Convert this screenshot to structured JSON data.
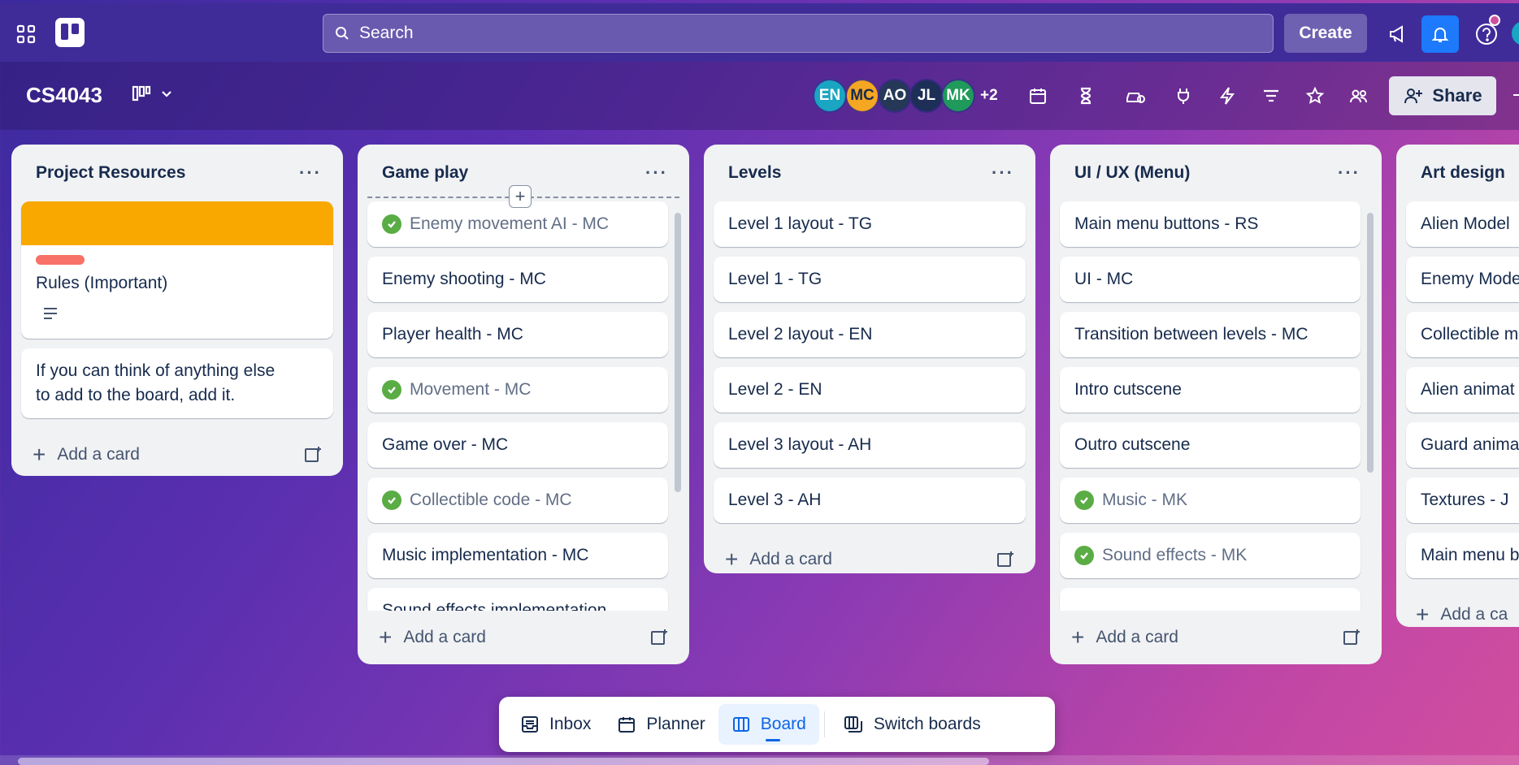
{
  "topbar": {
    "search_placeholder": "Search",
    "create_label": "Create"
  },
  "board": {
    "title": "CS4043",
    "members": [
      {
        "initials": "EN",
        "color": "#1aa5c2"
      },
      {
        "initials": "MC",
        "color": "#f5a623"
      },
      {
        "initials": "AO",
        "color": "#253858"
      },
      {
        "initials": "JL",
        "color": "#1d2f57"
      },
      {
        "initials": "MK",
        "color": "#1f9a5a"
      }
    ],
    "more_members": "+2",
    "share_label": "Share"
  },
  "lists": [
    {
      "title": "Project Resources",
      "cards": [
        {
          "title": "Rules (Important)",
          "cover_color": "#f9a800",
          "label_color": "#f87168",
          "has_description": true
        },
        {
          "title": "If you can think of anything else to add to the board, add it."
        }
      ],
      "add_label": "Add a card"
    },
    {
      "title": "Game play",
      "cards": [
        {
          "title": "Enemy movement AI - MC",
          "done": true
        },
        {
          "title": "Enemy shooting - MC"
        },
        {
          "title": "Player health - MC"
        },
        {
          "title": "Movement - MC",
          "done": true
        },
        {
          "title": "Game over - MC"
        },
        {
          "title": "Collectible code - MC",
          "done": true
        },
        {
          "title": "Music implementation - MC"
        },
        {
          "title": "Sound effects implementation"
        }
      ],
      "add_label": "Add a card"
    },
    {
      "title": "Levels",
      "cards": [
        {
          "title": "Level 1 layout - TG"
        },
        {
          "title": "Level 1 - TG"
        },
        {
          "title": "Level 2 layout - EN"
        },
        {
          "title": "Level 2 - EN"
        },
        {
          "title": "Level 3 layout - AH"
        },
        {
          "title": "Level 3 - AH"
        }
      ],
      "add_label": "Add a card"
    },
    {
      "title": "UI / UX (Menu)",
      "cards": [
        {
          "title": "Main menu buttons - RS"
        },
        {
          "title": "UI - MC"
        },
        {
          "title": "Transition between levels - MC"
        },
        {
          "title": "Intro cutscene"
        },
        {
          "title": "Outro cutscene"
        },
        {
          "title": "Music - MK",
          "done": true
        },
        {
          "title": "Sound effects - MK",
          "done": true
        }
      ],
      "add_label": "Add a card"
    },
    {
      "title": "Art design",
      "cards": [
        {
          "title": "Alien Model"
        },
        {
          "title": "Enemy Mode"
        },
        {
          "title": "Collectible m"
        },
        {
          "title": "Alien animat"
        },
        {
          "title": "Guard anima"
        },
        {
          "title": "Textures - J"
        },
        {
          "title": "Main menu b"
        }
      ],
      "add_label": "Add a ca"
    }
  ],
  "dock": {
    "inbox": "Inbox",
    "planner": "Planner",
    "board": "Board",
    "switch": "Switch boards"
  }
}
